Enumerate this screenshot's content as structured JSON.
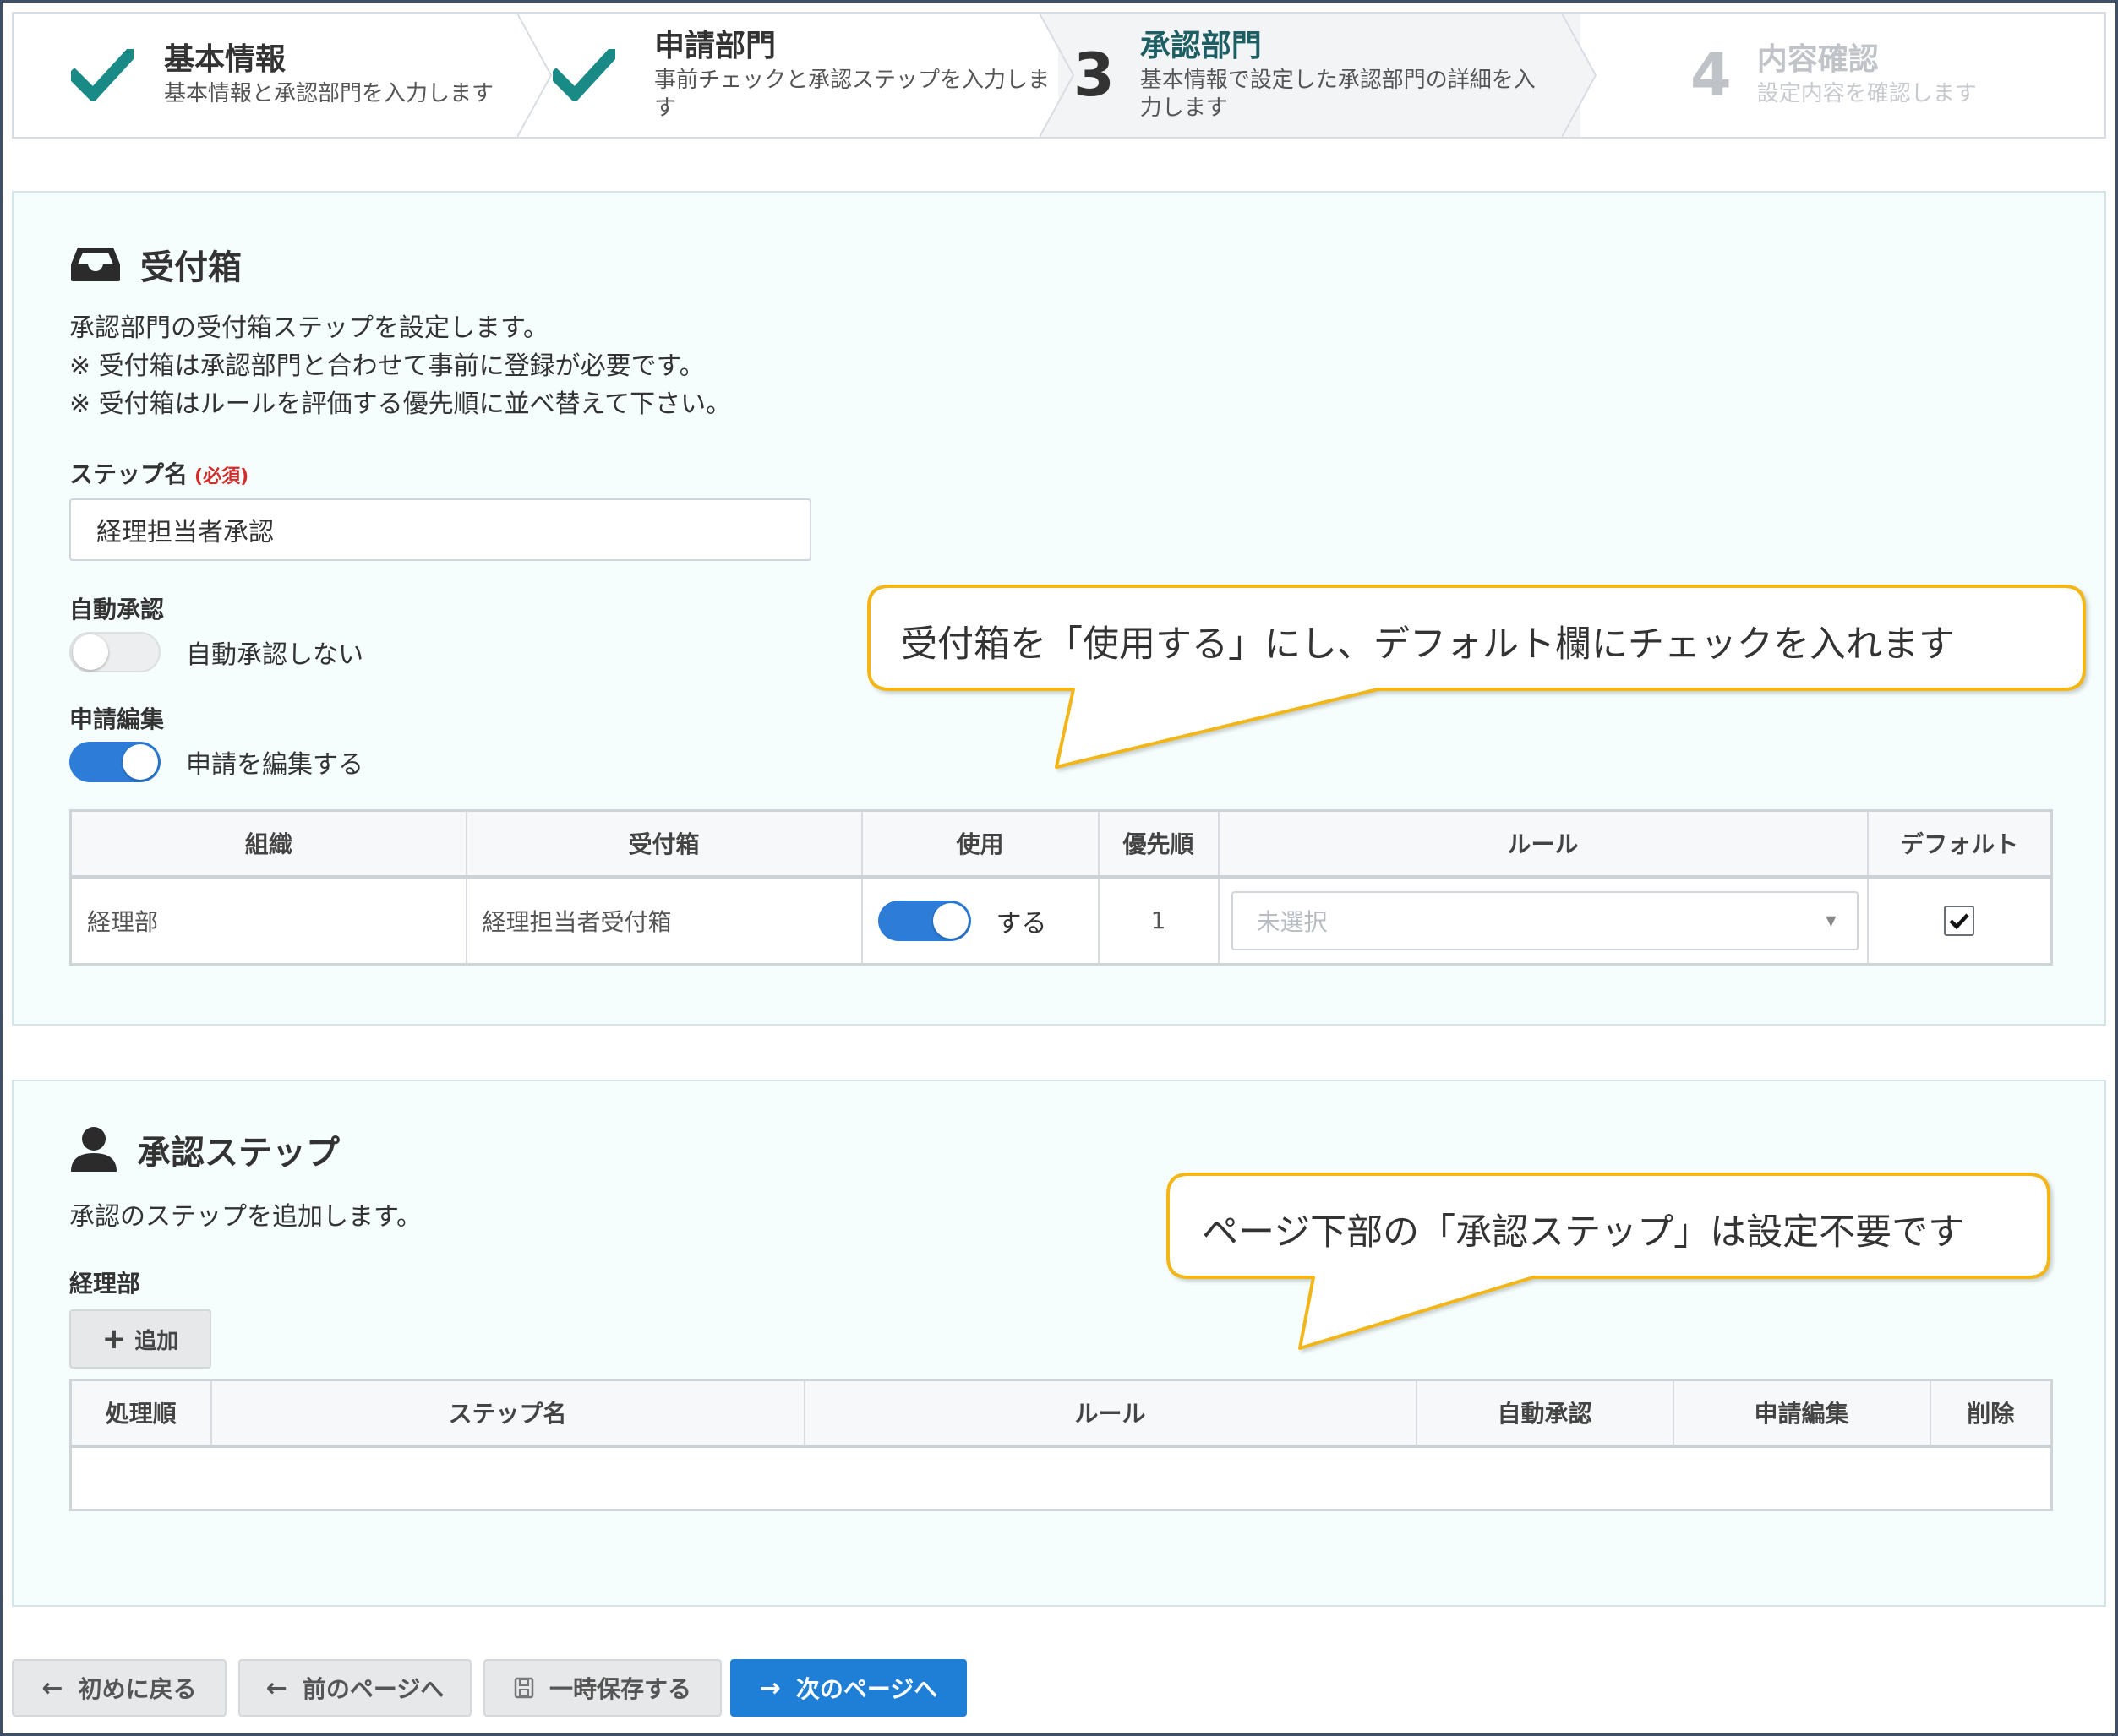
{
  "stepper": {
    "steps": [
      {
        "number": "",
        "title": "基本情報",
        "desc": "基本情報と承認部門を入力します",
        "state": "done"
      },
      {
        "number": "",
        "title": "申請部門",
        "desc": "事前チェックと承認ステップを入力します",
        "state": "done"
      },
      {
        "number": "3",
        "title": "承認部門",
        "desc": "基本情報で設定した承認部門の詳細を入力します",
        "state": "current"
      },
      {
        "number": "4",
        "title": "内容確認",
        "desc": "設定内容を確認します",
        "state": "upcoming"
      }
    ]
  },
  "inbox_section": {
    "title": "受付箱",
    "description": [
      "承認部門の受付箱ステップを設定します。",
      "※ 受付箱は承認部門と合わせて事前に登録が必要です。",
      "※ 受付箱はルールを評価する優先順に並べ替えて下さい。"
    ],
    "step_name_label": "ステップ名",
    "required_label": "(必須)",
    "step_name_value": "経理担当者承認",
    "auto_approve_label": "自動承認",
    "auto_approve_toggle_label": "自動承認しない",
    "auto_approve_on": false,
    "edit_label": "申請編集",
    "edit_toggle_label": "申請を編集する",
    "edit_on": true,
    "table": {
      "headers": [
        "組織",
        "受付箱",
        "使用",
        "優先順",
        "ルール",
        "デフォルト"
      ],
      "rows": [
        {
          "org": "経理部",
          "inbox": "経理担当者受付箱",
          "use_label": "する",
          "use_on": true,
          "priority": "1",
          "rule_placeholder": "未選択",
          "default_checked": true
        }
      ]
    }
  },
  "approval_section": {
    "title": "承認ステップ",
    "description": "承認のステップを追加します。",
    "department_label": "経理部",
    "add_button": "追加",
    "table": {
      "headers": [
        "処理順",
        "ステップ名",
        "ルール",
        "自動承認",
        "申請編集",
        "削除"
      ],
      "rows": []
    }
  },
  "callouts": {
    "inbox_note": "受付箱を「使用する」にし、デフォルト欄にチェックを入れます",
    "approval_note": "ページ下部の「承認ステップ」は設定不要です"
  },
  "footer": {
    "back_to_start": "初めに戻る",
    "prev_page": "前のページへ",
    "save_draft": "一時保存する",
    "next_page": "次のページへ"
  },
  "colors": {
    "accent_teal": "#1a8a87",
    "toggle_on": "#2d7dd8",
    "primary_button": "#1f7fd6",
    "callout_border": "#f2b619",
    "required_red": "#d12d2d"
  }
}
